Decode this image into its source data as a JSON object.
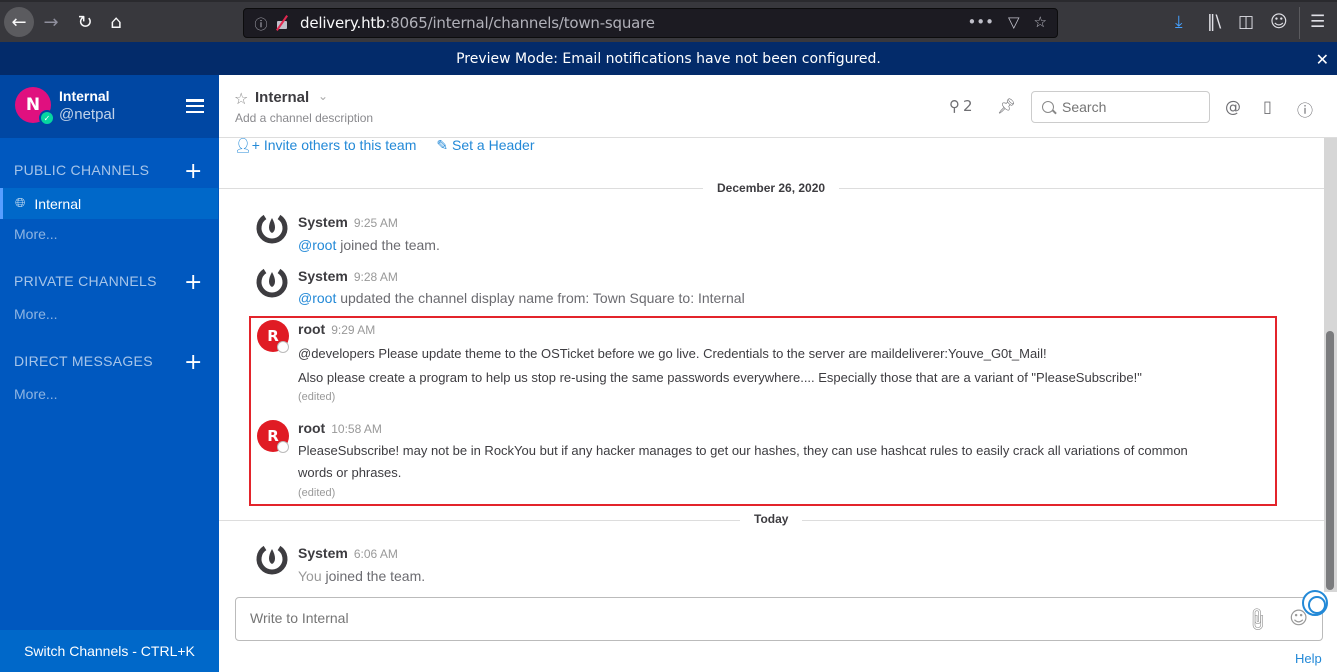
{
  "browser": {
    "url_host": "delivery.htb",
    "url_rest": ":8065/internal/channels/town-square",
    "icons": [
      "back-icon",
      "forward-icon",
      "reload-icon",
      "home-icon",
      "info-icon",
      "insecure-lock-icon",
      "more-dots-icon",
      "pocket-icon",
      "bookmark-star-icon",
      "download-icon",
      "library-icon",
      "sidebar-icon",
      "account-icon",
      "menu-icon"
    ]
  },
  "banner": {
    "text": "Preview Mode: Email notifications have not been configured.",
    "close": "✕"
  },
  "sidebar": {
    "team_initial": "N",
    "team_name": "Internal",
    "username": "@netpal",
    "sections": [
      {
        "title": "PUBLIC CHANNELS",
        "add": "+",
        "more": "More..."
      },
      {
        "title": "PRIVATE CHANNELS",
        "add": "+",
        "more": "More..."
      },
      {
        "title": "DIRECT MESSAGES",
        "add": "+",
        "more": "More..."
      }
    ],
    "active_channel": "Internal",
    "switch_channels": "Switch Channels - CTRL+K"
  },
  "channel_header": {
    "name": "Internal",
    "description": "Add a channel description",
    "member_count": "2",
    "search_placeholder": "Search"
  },
  "intro": {
    "invite": "Invite others to this team",
    "set_header": "Set a Header"
  },
  "messages": {
    "date1": "December 26, 2020",
    "date2": "Today",
    "posts": [
      {
        "user": "System",
        "time": "9:25 AM",
        "mention": "@root",
        "text": " joined the team."
      },
      {
        "user": "System",
        "time": "9:28 AM",
        "mention": "@root",
        "text": " updated the channel display name from: Town Square to: Internal"
      },
      {
        "user": "root",
        "avatar": "R",
        "time": "9:29 AM",
        "line1": "@developers Please update theme to the OSTicket before we go live.  Credentials to the server are maildeliverer:Youve_G0t_Mail!",
        "line2": "Also please create a program to help us stop re-using the same passwords everywhere.... Especially those that are a variant of \"PleaseSubscribe!\"",
        "edited": "(edited)"
      },
      {
        "user": "root",
        "avatar": "R",
        "time": "10:58 AM",
        "line1": "PleaseSubscribe! may not be in RockYou but if any hacker manages to get our hashes, they can use hashcat rules to easily crack all variations of common",
        "line2": "words or phrases.",
        "edited": "(edited)"
      },
      {
        "user": "System",
        "time": "6:06 AM",
        "mention": "You",
        "text": " joined the team."
      }
    ]
  },
  "composer": {
    "placeholder": "Write to Internal",
    "help": "Help"
  },
  "scrollbar": {
    "position_fraction": 1.0,
    "visible_fraction": 0.58
  }
}
